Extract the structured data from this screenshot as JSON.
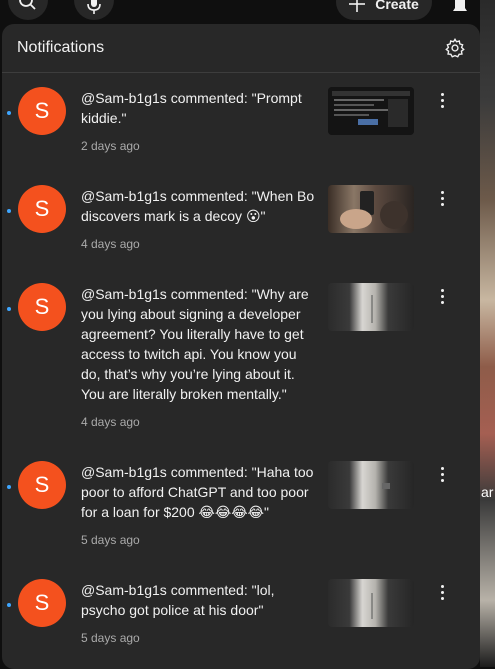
{
  "header": {
    "create_label": "Create"
  },
  "panel": {
    "title": "Notifications"
  },
  "notifications": [
    {
      "avatar_letter": "S",
      "text": "@Sam-b1g1s commented: \"Prompt kiddie.\"",
      "time": "2 days ago"
    },
    {
      "avatar_letter": "S",
      "text": "@Sam-b1g1s commented: \"When Bo discovers mark is a decoy 😮\"",
      "time": "4 days ago"
    },
    {
      "avatar_letter": "S",
      "text": "@Sam-b1g1s commented: \"Why are you lying about signing a developer agreement? You literally have to get access to twitch api. You know you do, that’s why you’re lying about it. You are literally broken mentally.\"",
      "time": "4 days ago"
    },
    {
      "avatar_letter": "S",
      "text": "@Sam-b1g1s commented: \"Haha too poor to afford ChatGPT and too poor for a loan for $200 😂😂😂😂\"",
      "time": "5 days ago"
    },
    {
      "avatar_letter": "S",
      "text": "@Sam-b1g1s commented: \"lol, psycho got police at his door\"",
      "time": "5 days ago"
    }
  ],
  "background": {
    "edge_text": "ar"
  },
  "colors": {
    "panel_bg": "#282828",
    "avatar": "#f4511e",
    "unread_dot": "#3ea6ff",
    "secondary_text": "#aaaaaa"
  }
}
